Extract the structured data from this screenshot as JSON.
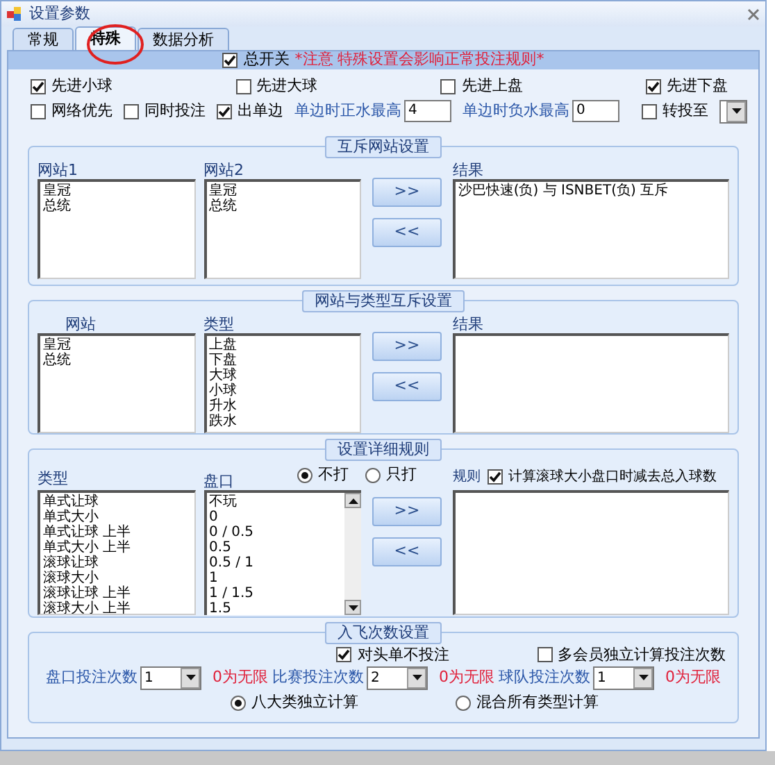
{
  "window": {
    "title": "设置参数"
  },
  "tabs": [
    {
      "label": "常规",
      "selected": false
    },
    {
      "label": "特殊",
      "selected": true
    },
    {
      "label": "数据分析",
      "selected": false
    }
  ],
  "master_switch": {
    "label": "总开关",
    "checked": true,
    "note": "*注意 特殊设置会影响正常投注规则*"
  },
  "options_row1": [
    {
      "label": "先进小球",
      "checked": true
    },
    {
      "label": "先进大球",
      "checked": false
    },
    {
      "label": "先进上盘",
      "checked": false
    },
    {
      "label": "先进下盘",
      "checked": true
    }
  ],
  "options_row2": [
    {
      "kind": "checkbox",
      "label": "网络优先",
      "checked": false
    },
    {
      "kind": "checkbox",
      "label": "同时投注",
      "checked": false
    },
    {
      "kind": "checkbox",
      "label": "出单边",
      "checked": true
    },
    {
      "kind": "field",
      "label": "单边时正水最高",
      "value": "4"
    },
    {
      "kind": "field",
      "label": "单边时负水最高",
      "value": "0"
    },
    {
      "kind": "checkbox",
      "label": "转投至",
      "checked": false
    },
    {
      "kind": "dropdown"
    }
  ],
  "site_exclusion": {
    "title": "互斥网站设置",
    "lists": [
      {
        "label": "网站1",
        "items": [
          "皇冠",
          "总统"
        ]
      },
      {
        "label": "网站2",
        "items": [
          "皇冠",
          "总统"
        ]
      }
    ],
    "buttons": [
      ">>",
      "<<"
    ],
    "result": {
      "label": "结果",
      "items": [
        "沙巴快速(负) 与 ISNBET(负) 互斥"
      ]
    }
  },
  "site_type_exclusion": {
    "title": "网站与类型互斥设置",
    "lists": [
      {
        "label": "网站",
        "items": [
          "皇冠",
          "总统"
        ]
      },
      {
        "label": "类型",
        "items": [
          "上盘",
          "下盘",
          "大球",
          "小球",
          "升水",
          "跌水"
        ]
      }
    ],
    "buttons": [
      ">>",
      "<<"
    ],
    "result": {
      "label": "结果"
    }
  },
  "detail_rules": {
    "title": "设置详细规则",
    "type_list": {
      "label": "类型",
      "items": [
        "单式让球",
        "单式大小",
        "单式让球 上半",
        "单式大小 上半",
        "滚球让球",
        "滚球大小",
        "滚球让球 上半",
        "滚球大小 上半"
      ]
    },
    "handicap_list": {
      "label": "盘口",
      "items": [
        "不玩",
        "0",
        "0 / 0.5",
        "0.5",
        "0.5 / 1",
        "1",
        "1 / 1.5",
        "1.5"
      ]
    },
    "radios": [
      {
        "label": "不打",
        "selected": true
      },
      {
        "label": "只打",
        "selected": false
      }
    ],
    "buttons": [
      ">>",
      "<<"
    ],
    "rules": {
      "label": "规则",
      "checkbox": {
        "label": "计算滚球大小盘口时减去总入球数",
        "checked": true
      }
    }
  },
  "bet_count": {
    "title": "入飞次数设置",
    "checkboxes": [
      {
        "label": "对头单不投注",
        "checked": true
      },
      {
        "label": "多会员独立计算投注次数",
        "checked": false
      }
    ],
    "counters": [
      {
        "label": "盘口投注次数",
        "value": "1",
        "hint": "0为无限"
      },
      {
        "label": "比赛投注次数",
        "value": "2",
        "hint": "0为无限"
      },
      {
        "label": "球队投注次数",
        "value": "1",
        "hint": "0为无限"
      }
    ],
    "radios": [
      {
        "label": "八大类独立计算",
        "selected": true
      },
      {
        "label": "混合所有类型计算",
        "selected": false
      }
    ]
  }
}
